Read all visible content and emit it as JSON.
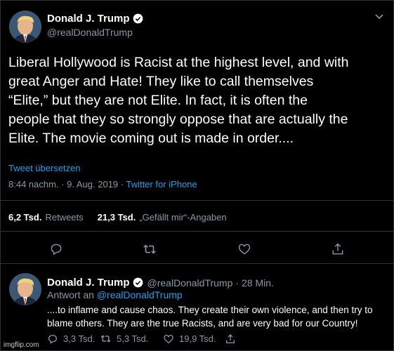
{
  "colors": {
    "background": "#000000",
    "link": "#1da1f2",
    "muted": "#8899a6",
    "text": "#ffffff",
    "divider": "#2f3336"
  },
  "main_tweet": {
    "display_name": "Donald J. Trump",
    "handle": "@realDonaldTrump",
    "text": "Liberal Hollywood is Racist at the highest level, and with\ngreat Anger and Hate! They like to call themselves\n“Elite,” but they are not Elite. In fact, it is often the\npeople that they so strongly oppose that are actually the\nElite. The movie coming out is made in order....",
    "translate_link": "Tweet übersetzen",
    "time": "8:44 nachm.",
    "separator": "·",
    "date": "9. Aug. 2019",
    "source": "Twitter for iPhone",
    "retweets_count": "6,2 Tsd.",
    "retweets_label": "Retweets",
    "likes_count": "21,3 Tsd.",
    "likes_label": "„Gefällt mir“-Angaben",
    "icons": [
      "reply-icon",
      "retweet-icon",
      "like-icon",
      "share-icon",
      "verified-badge-icon",
      "chevron-down-icon"
    ]
  },
  "reply_tweet": {
    "display_name": "Donald J. Trump",
    "handle": "@realDonaldTrump",
    "separator": "·",
    "time": "28 Min.",
    "reply_prefix": "Antwort an",
    "reply_to": "@realDonaldTrump",
    "text": "....to inflame and cause chaos. They create their own violence, and then try to\nblame others. They are the true Racists, and are very bad for our Country!",
    "replies": "3,3 Tsd.",
    "retweets": "5,3 Tsd.",
    "likes": "19,9 Tsd."
  },
  "watermark": "imgflip.com"
}
